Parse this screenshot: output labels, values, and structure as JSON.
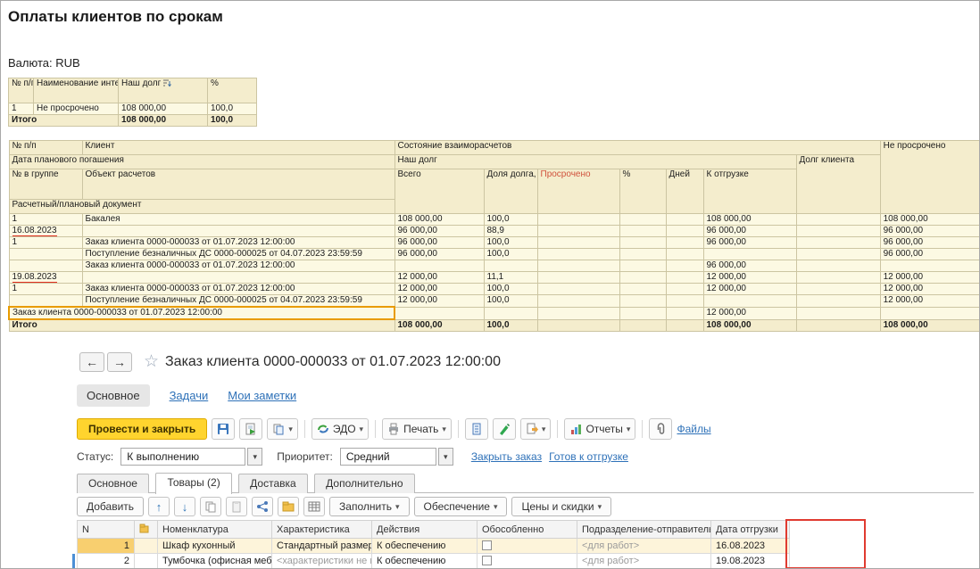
{
  "glyphs": {
    "back": "←",
    "forward": "→",
    "star": "☆",
    "caret": "▾",
    "up": "↑",
    "down": "↓"
  },
  "report": {
    "title": "Оплаты клиентов по срокам",
    "currency": "Валюта: RUB",
    "summary": {
      "h_num": "№ п/п",
      "h_name": "Наименование интервала",
      "h_debt": "Наш долг",
      "h_pct": "%",
      "row1": {
        "num": "1",
        "name": "Не просрочено",
        "debt": "108 000,00",
        "pct": "100,0"
      },
      "total": {
        "label": "Итого",
        "debt": "108 000,00",
        "pct": "100,0"
      }
    },
    "main": {
      "h": {
        "npp": "№ п/п",
        "client": "Клиент",
        "state": "Состояние взаиморасчетов",
        "not_overdue": "Не просрочено",
        "plan_date": "Дата планового погашения",
        "our_debt": "Наш долг",
        "client_debt": "Долг клиента",
        "n_group": "№ в группе",
        "calc_object": "Объект расчетов",
        "total": "Всего",
        "share": "Доля долга, %",
        "overdue": "Просрочено",
        "pct": "%",
        "days": "Дней",
        "to_ship": "К отгрузке",
        "doc": "Расчетный/плановый документ"
      },
      "rows": [
        {
          "a": "1",
          "b": "Бакалея",
          "total": "108 000,00",
          "share": "100,0",
          "ship": "108 000,00",
          "not_overdue": "108 000,00"
        },
        {
          "a": "16.08.2023",
          "total": "96 000,00",
          "share": "88,9",
          "ship": "96 000,00",
          "not_overdue": "96 000,00"
        },
        {
          "a": "1",
          "b": "Заказ клиента 0000-000033 от 01.07.2023 12:00:00",
          "total": "96 000,00",
          "share": "100,0",
          "ship": "96 000,00",
          "not_overdue": "96 000,00"
        },
        {
          "b": "Поступление безналичных ДС 0000-000025 от 04.07.2023 23:59:59",
          "total": "96 000,00",
          "share": "100,0",
          "not_overdue": "96 000,00"
        },
        {
          "b": "Заказ клиента 0000-000033 от 01.07.2023 12:00:00",
          "ship": "96 000,00"
        },
        {
          "a": "19.08.2023",
          "total": "12 000,00",
          "share": "11,1",
          "ship": "12 000,00",
          "not_overdue": "12 000,00"
        },
        {
          "a": "1",
          "b": "Заказ клиента 0000-000033 от 01.07.2023 12:00:00",
          "total": "12 000,00",
          "share": "100,0",
          "ship": "12 000,00",
          "not_overdue": "12 000,00"
        },
        {
          "b": "Поступление безналичных ДС 0000-000025 от 04.07.2023 23:59:59",
          "total": "12 000,00",
          "share": "100,0",
          "not_overdue": "12 000,00"
        },
        {
          "b": "Заказ клиента 0000-000033 от 01.07.2023 12:00:00",
          "ship": "12 000,00"
        },
        {
          "a": "Итого",
          "total": "108 000,00",
          "share": "100,0",
          "ship": "108 000,00",
          "not_overdue": "108 000,00"
        }
      ]
    }
  },
  "order": {
    "title": "Заказ клиента 0000-000033 от 01.07.2023 12:00:00",
    "nav_tabs": {
      "main": "Основное",
      "tasks": "Задачи",
      "notes": "Мои заметки"
    },
    "toolbar": {
      "post_close": "Провести и закрыть",
      "edo": "ЭДО",
      "print": "Печать",
      "reports": "Отчеты",
      "files": "Файлы"
    },
    "status": {
      "status_label": "Статус:",
      "status_value": "К выполнению",
      "priority_label": "Приоритет:",
      "priority_value": "Средний",
      "close_order": "Закрыть заказ",
      "ready_to_ship": "Готов к отгрузке"
    },
    "form_tabs": {
      "main": "Основное",
      "goods": "Товары (2)",
      "delivery": "Доставка",
      "extra": "Дополнительно"
    },
    "grid_toolbar": {
      "add": "Добавить",
      "fill": "Заполнить",
      "provision": "Обеспечение",
      "prices": "Цены и скидки"
    },
    "products": {
      "h": {
        "n": "N",
        "nomenclature": "Номенклатура",
        "characteristic": "Характеристика",
        "actions": "Действия",
        "separate": "Обособленно",
        "department": "Подразделение-отправитель",
        "ship_date": "Дата отгрузки"
      },
      "rows": [
        {
          "n": "1",
          "nomenclature": "Шкаф кухонный",
          "characteristic": "Стандартный размер",
          "actions": "К обеспечению",
          "department": "<для работ>",
          "ship_date": "16.08.2023"
        },
        {
          "n": "2",
          "nomenclature": "Тумбочка (офисная меб...",
          "characteristic": "<характеристики не исп...",
          "actions": "К обеспечению",
          "department": "<для работ>",
          "ship_date": "19.08.2023"
        }
      ]
    }
  }
}
